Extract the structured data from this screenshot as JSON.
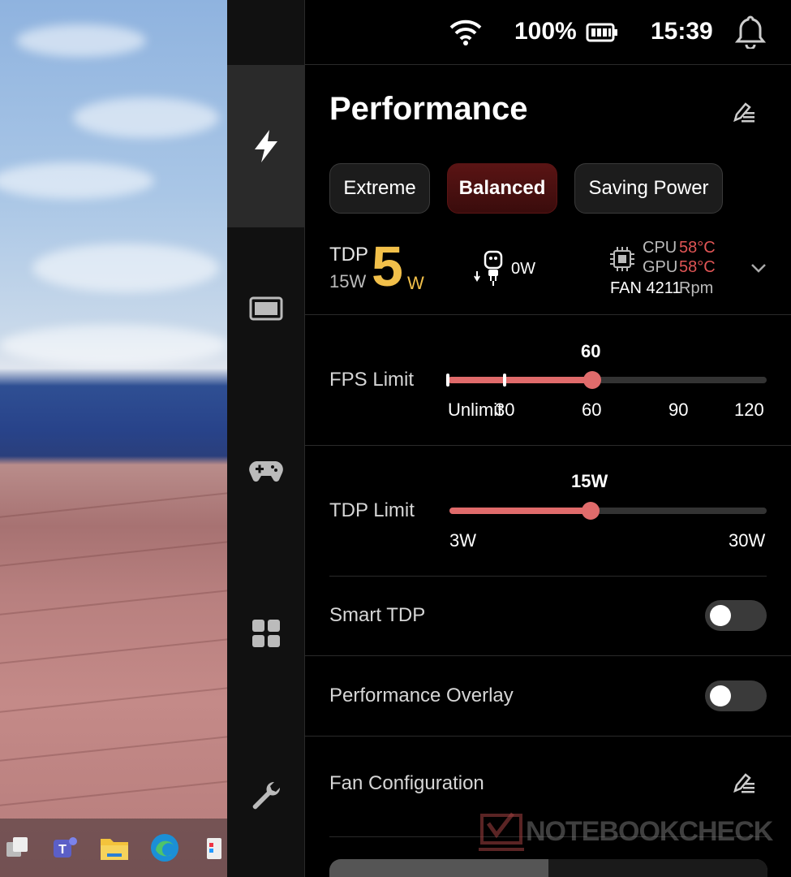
{
  "status_bar": {
    "battery": "100%",
    "time": "15:39"
  },
  "panel": {
    "title": "Performance"
  },
  "modes": [
    {
      "label": "Extreme",
      "selected": false
    },
    {
      "label": "Balanced",
      "selected": true
    },
    {
      "label": "Saving Power",
      "selected": false
    }
  ],
  "tdp_info": {
    "tdp_label": "TDP",
    "tdp_limit": "15W",
    "tdp_value": "5",
    "tdp_unit": "W",
    "power_in": "0W",
    "cpu_label": "CPU",
    "cpu_temp": "58°C",
    "gpu_label": "GPU",
    "gpu_temp": "58°C",
    "fan_label": "FAN 4211",
    "fan_unit": "Rpm"
  },
  "fps_limit": {
    "label": "FPS Limit",
    "value_label": "60",
    "ticks": [
      "Unlimit",
      "30",
      "60",
      "90",
      "120"
    ],
    "current_index": 2
  },
  "tdp_limit": {
    "label": "TDP Limit",
    "value_label": "15W",
    "min_label": "3W",
    "max_label": "30W",
    "value": 15,
    "min": 3,
    "max": 30
  },
  "smart_tdp": {
    "label": "Smart TDP",
    "on": false
  },
  "performance_overlay": {
    "label": "Performance Overlay",
    "on": false
  },
  "fan_configuration": {
    "label": "Fan Configuration"
  },
  "watermark": "NOTEBOOKCHECK",
  "colors": {
    "accent": "#e06b6b",
    "selected_mode": "#4a1010",
    "temp": "#e05555",
    "tdp_value": "#f2c04a"
  }
}
